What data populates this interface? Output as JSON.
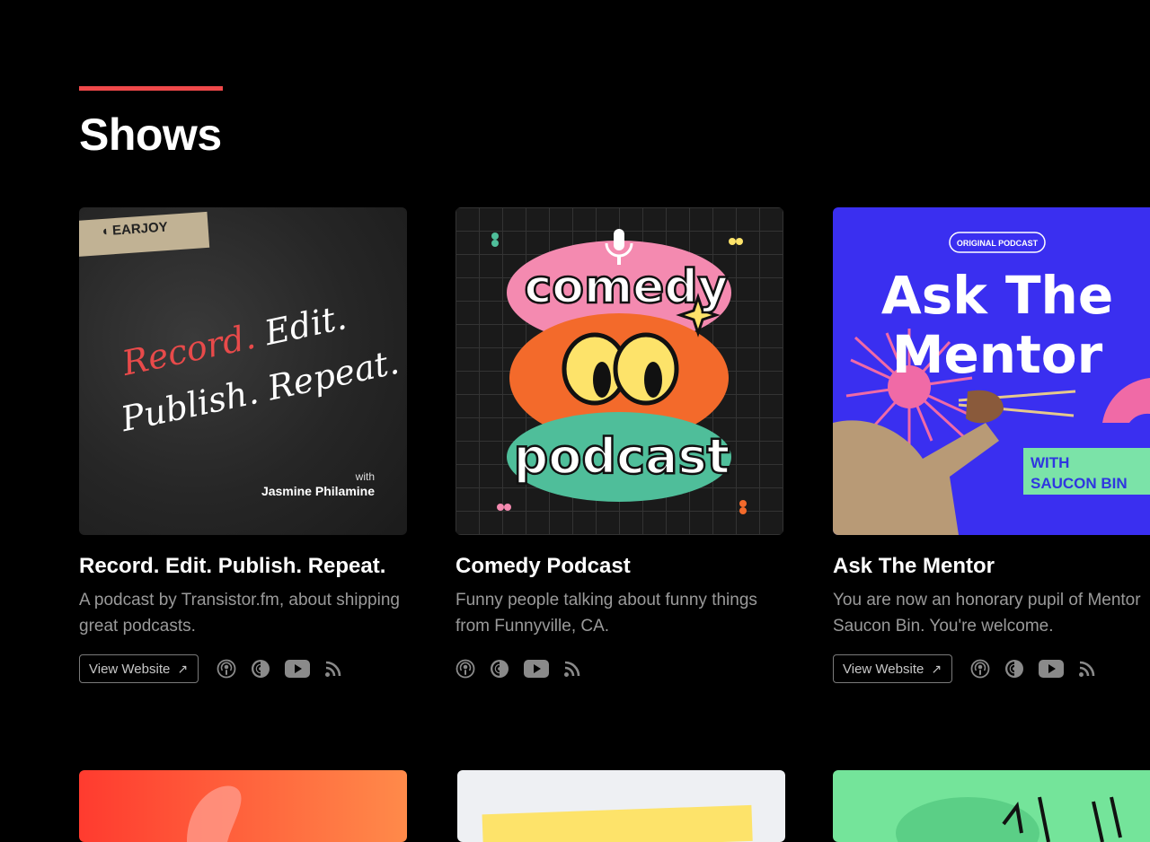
{
  "page": {
    "title": "Shows"
  },
  "shows": [
    {
      "title": "Record. Edit. Publish. Repeat.",
      "description": "A podcast by Transistor.fm, about shipping great podcasts.",
      "view_label": "View Website",
      "cover": {
        "brand": "EARJOY",
        "line1a": "Record.",
        "line1b": "Edit.",
        "line2": "Publish. Repeat.",
        "with": "with",
        "host": "Jasmine Philamine"
      },
      "icons": [
        "apple-podcasts-icon",
        "pocket-casts-icon",
        "youtube-icon",
        "rss-icon"
      ]
    },
    {
      "title": "Comedy Podcast",
      "description": "Funny people talking about funny things from Funnyville, CA.",
      "cover": {
        "top": "comedy",
        "bottom": "podcast"
      },
      "icons": [
        "apple-podcasts-icon",
        "pocket-casts-icon",
        "youtube-icon",
        "rss-icon"
      ]
    },
    {
      "title": "Ask The Mentor",
      "description": "You are now an honorary pupil of Mentor Saucon Bin. You're welcome.",
      "view_label": "View Website",
      "cover": {
        "badge": "ORIGINAL PODCAST",
        "line1": "Ask The",
        "line2": "Mentor",
        "with_line1": "WITH",
        "with_line2": "SAUCON BIN"
      },
      "icons": [
        "apple-podcasts-icon",
        "pocket-casts-icon",
        "youtube-icon",
        "rss-icon"
      ]
    }
  ],
  "colors": {
    "accent": "#f0494a",
    "background": "#000000",
    "muted_text": "#9a9a9a"
  }
}
